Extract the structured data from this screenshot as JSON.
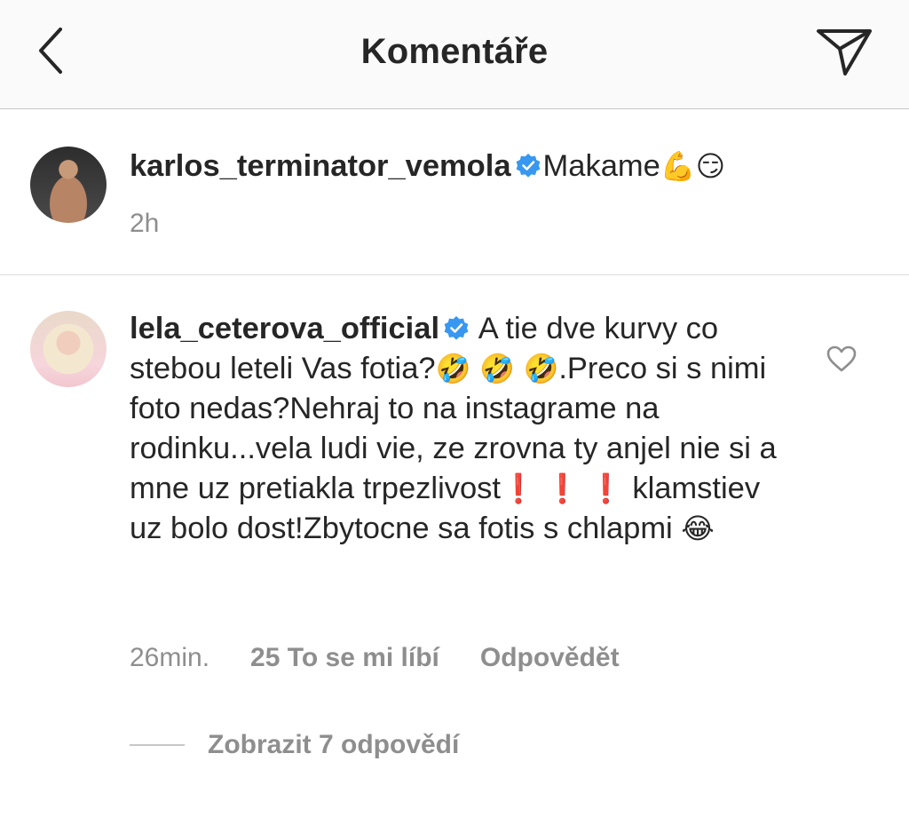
{
  "header": {
    "title": "Komentáře",
    "back_icon": "chevron-left-icon",
    "send_icon": "paper-plane-icon"
  },
  "caption": {
    "username": "karlos_terminator_vemola",
    "text": "Makame",
    "emojis": [
      "💪",
      "😏"
    ],
    "time": "2h"
  },
  "comment": {
    "username": "lela_ceterova_official",
    "text_parts": [
      " A tie dve kurvy co stebou leteli Vas fotia?",
      "🤣",
      " ",
      "🤣",
      " ",
      "🤣",
      ".Preco si s nimi foto nedas?Nehraj to na instagrame na rodinku...vela ludi vie, ze zrovna ty anjel nie si a mne uz pretiakla trpezlivost",
      "❗",
      " ",
      "❗",
      " ",
      "❗",
      " klamstiev uz bolo dost!Zbytocne sa fotis s chlapmi ",
      "😂"
    ],
    "time": "26min.",
    "likes": "25 To se mi líbí",
    "reply": "Odpovědět",
    "view_replies": "Zobrazit 7 odpovědí"
  },
  "colors": {
    "verified": "#3897f0",
    "muted": "#8e8e8e",
    "exclamation": "#e0242b",
    "emoji_yellow": "#f6c327"
  }
}
